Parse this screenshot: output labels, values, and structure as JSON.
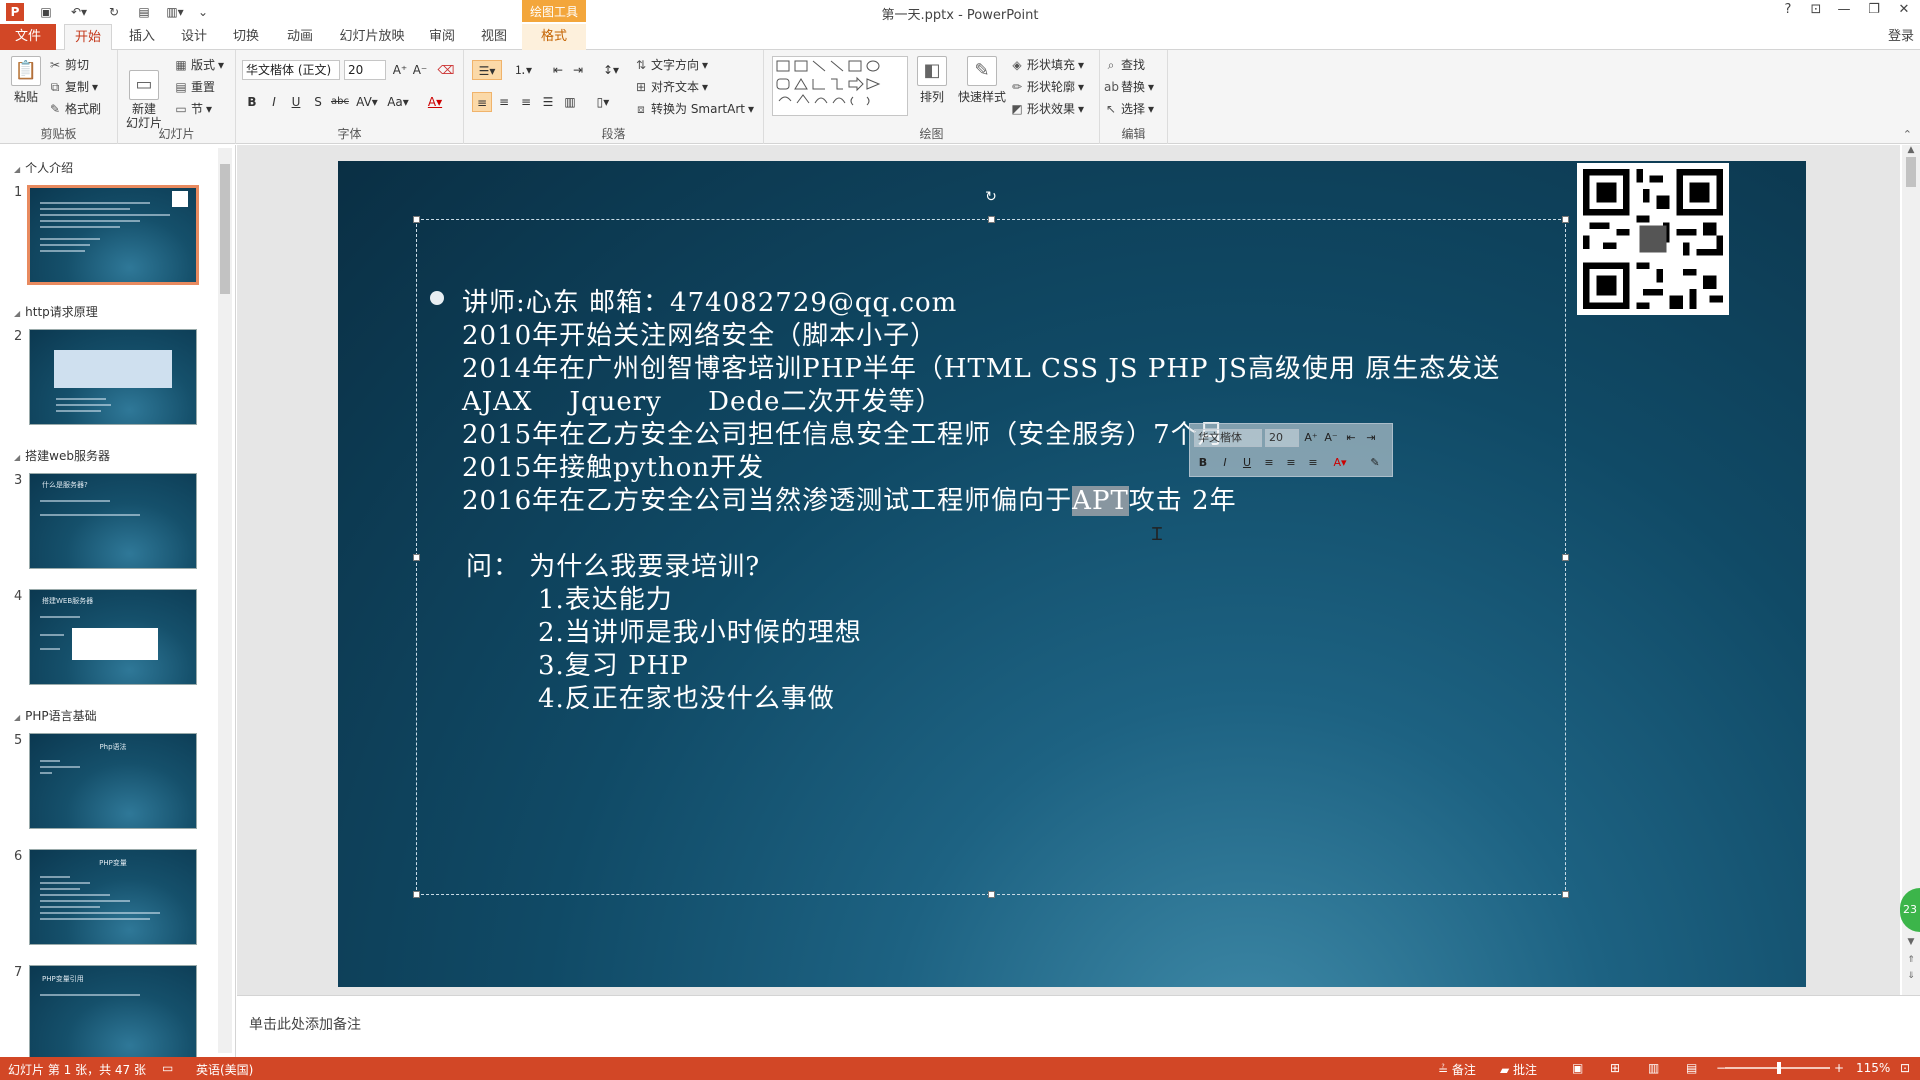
{
  "app": {
    "doc_title": "第一天.pptx - PowerPoint",
    "contextual_tool": "绘图工具",
    "window_help": "?",
    "login": "登录"
  },
  "tabs": [
    {
      "label": "文件"
    },
    {
      "label": "开始"
    },
    {
      "label": "插入"
    },
    {
      "label": "设计"
    },
    {
      "label": "切换"
    },
    {
      "label": "动画"
    },
    {
      "label": "幻灯片放映"
    },
    {
      "label": "审阅"
    },
    {
      "label": "视图"
    },
    {
      "label": "格式"
    }
  ],
  "ribbon": {
    "clipboard": {
      "label": "剪贴板",
      "paste": "粘贴",
      "cut": "剪切",
      "copy": "复制",
      "format_painter": "格式刷"
    },
    "slides": {
      "label": "幻灯片",
      "new_slide": "新建\n幻灯片",
      "layout": "版式",
      "reset": "重置",
      "section": "节"
    },
    "font": {
      "label": "字体",
      "font_name": "华文楷体 (正文)",
      "font_size": "20"
    },
    "paragraph": {
      "label": "段落",
      "text_direction": "文字方向",
      "align_text": "对齐文本",
      "smartart": "转换为 SmartArt"
    },
    "drawing": {
      "label": "绘图",
      "arrange": "排列",
      "quick_styles": "快速样式",
      "shape_fill": "形状填充",
      "shape_outline": "形状轮廓",
      "shape_effects": "形状效果"
    },
    "editing": {
      "label": "编辑",
      "find": "查找",
      "replace": "替换",
      "select": "选择"
    }
  },
  "thumbnails": {
    "sections": [
      {
        "name": "个人介绍"
      },
      {
        "name": "http请求原理"
      },
      {
        "name": "搭建web服务器"
      },
      {
        "name": "PHP语言基础"
      }
    ],
    "slides": [
      {
        "num": "1",
        "title": ""
      },
      {
        "num": "2",
        "title": ""
      },
      {
        "num": "3",
        "title": "什么是服务器?"
      },
      {
        "num": "4",
        "title": "搭建WEB服务器"
      },
      {
        "num": "5",
        "title": "Php语法"
      },
      {
        "num": "6",
        "title": "PHP变量"
      },
      {
        "num": "7",
        "title": "PHP变量引用"
      }
    ]
  },
  "slide": {
    "lines": [
      "讲师:心东 邮箱：474082729@qq.com",
      "2010年开始关注网络安全（脚本小子）",
      "2014年在广州创智博客培训PHP半年（HTML CSS JS PHP JS高级使用 原生态发送",
      "AJAX    Jquery     Dede二次开发等）",
      "2015年在乙方安全公司担任信息安全工程师（安全服务）7个月",
      "2015年接触python开发"
    ],
    "line7_pre": "2016年在乙方安全公司当然渗透测试工程师偏向于",
    "line7_sel": "APT",
    "line7_post": "攻击 2年",
    "question": "问：  为什么我要录培训?",
    "answers": [
      "1.表达能力",
      "2.当讲师是我小时候的理想",
      "3.复习 PHP",
      "4.反正在家也没什么事做"
    ]
  },
  "minibar": {
    "font_name": "华文楷体",
    "font_size": "20"
  },
  "badge": "23",
  "notes_placeholder": "单击此处添加备注",
  "status": {
    "slide_info": "幻灯片 第 1 张，共 47 张",
    "language": "英语(美国)",
    "notes": "备注",
    "comments": "批注",
    "zoom": "115%"
  }
}
